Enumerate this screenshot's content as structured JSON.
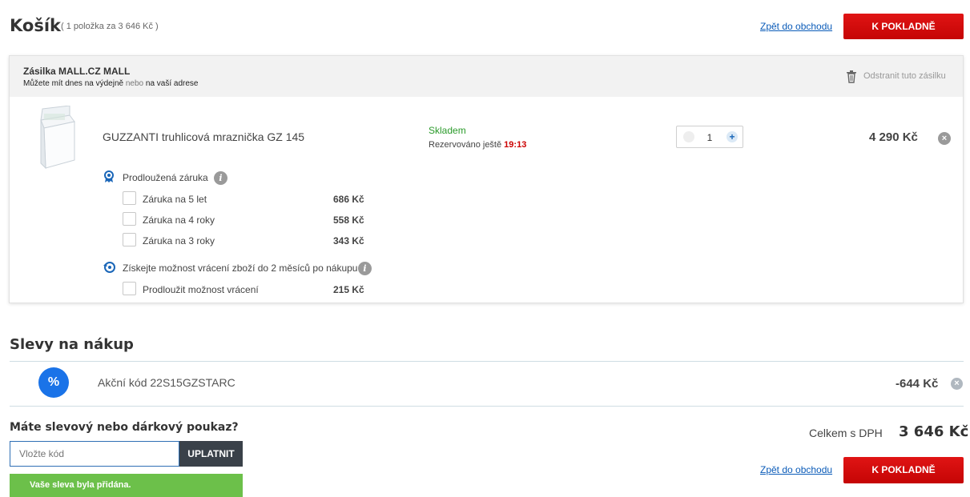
{
  "header": {
    "title": "Košík",
    "summary": "( 1 položka za 3 646 Kč )",
    "back_link": "Zpět do obchodu",
    "checkout_label": "K POKLADNĚ"
  },
  "shipment": {
    "title": "Zásilka MALL.CZ MALL",
    "subtitle_a": "Můžete mít dnes na výdejně",
    "subtitle_b": "nebo",
    "subtitle_c": "na vaší adrese",
    "remove_label": "Odstranit tuto zásilku",
    "item": {
      "name": "GUZZANTI truhlicová mraznička GZ 145",
      "stock": "Skladem",
      "reserved_label": "Rezervováno ještě",
      "reserved_time": "19:13",
      "quantity": "1",
      "price": "4 290 Kč"
    },
    "warranty": {
      "title": "Prodloužená záruka",
      "options": [
        {
          "label": "Záruka na 5 let",
          "price": "686 Kč"
        },
        {
          "label": "Záruka na 4 roky",
          "price": "558 Kč"
        },
        {
          "label": "Záruka na 3 roky",
          "price": "343 Kč"
        }
      ]
    },
    "returns": {
      "title": "Získejte možnost vrácení zboží do 2 měsíců po nákupu",
      "option": {
        "label": "Prodloužit možnost vrácení",
        "price": "215 Kč"
      }
    }
  },
  "discounts": {
    "title": "Slevy na nákup",
    "icon_symbol": "%",
    "code_label": "Akční kód 22S15GZSTARC",
    "amount": "-644 Kč"
  },
  "voucher": {
    "title": "Máte slevový nebo dárkový poukaz?",
    "placeholder": "Vložte kód",
    "apply_label": "UPLATNIT",
    "success_message": "Vaše sleva byla přidána."
  },
  "totals": {
    "label": "Celkem s DPH",
    "amount": "3 646 Kč"
  },
  "footer": {
    "back_link": "Zpět do obchodu",
    "checkout_label": "K POKLADNĚ"
  },
  "colors": {
    "accent_red": "#d40b0b",
    "stock_green": "#2a9a2a",
    "success_green": "#6cc04a",
    "link_blue": "#0a5bb8",
    "discount_blue": "#1a73e8"
  }
}
